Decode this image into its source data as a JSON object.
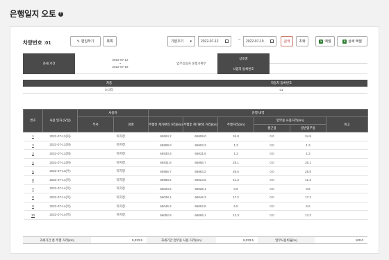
{
  "page": {
    "title": "은행일지 오토"
  },
  "vehicle": {
    "label": "차량번호 :01"
  },
  "toolbar": {
    "edit_label": "편집하기",
    "list_label": "목록",
    "period_select": "기본조기",
    "date_from": "2022-07-12",
    "date_to": "2022-07-19",
    "separator": "~",
    "search_label": "검색",
    "reset_label": "초화",
    "excel_label": "엑셀",
    "excel_detail_label": "상세 엑셀"
  },
  "info": {
    "period_label": "과세 기간",
    "period_start": "2022-07-12",
    "period_sep": "~",
    "period_end": "2022-07-19",
    "manager_label": "업무승용차 운행기록부",
    "trade_label": "상호명",
    "trade_value": "",
    "bizno_label": "사업자 등록번호",
    "bizno_value": "",
    "model_label": "차종",
    "model_value": "소나타",
    "reg_label": "자동차 등록번호",
    "reg_value": "01"
  },
  "table": {
    "headers": {
      "no": "번호",
      "date": "사용 일자 (요일)",
      "user": "사용자",
      "dept": "부서",
      "name": "성명",
      "run": "운행 내역",
      "before": "주행전 계기판의 거리(km)",
      "after": "주행후 계기판의 거리(km)",
      "dist": "주행거리(km)",
      "biz": "업무용 사용거리(km)",
      "commute": "출근용",
      "general": "일반업무용",
      "note": "비고"
    },
    "rows": [
      {
        "no": "1",
        "date": "2022-07-12(화)",
        "dept": "",
        "name": "미지정",
        "before": "65904.2",
        "after": "65909.0",
        "dist": "34.8",
        "commute": "0.0",
        "general": "34.8",
        "note": ""
      },
      {
        "no": "2",
        "date": "2022-07-12(화)",
        "dept": "",
        "name": "미지정",
        "before": "65909.0",
        "after": "65903.3",
        "dist": "1.3",
        "commute": "0.0",
        "general": "1.3",
        "note": ""
      },
      {
        "no": "3",
        "date": "2022-07-12(화)",
        "dept": "",
        "name": "미지정",
        "before": "65930.3",
        "after": "65931.6",
        "dist": "1.3",
        "commute": "0.0",
        "general": "1.3",
        "note": ""
      },
      {
        "no": "4",
        "date": "2022-07-12(화)",
        "dept": "",
        "name": "미지정",
        "before": "65931.6",
        "after": "65956.7",
        "dist": "25.1",
        "commute": "0.0",
        "general": "25.1",
        "note": ""
      },
      {
        "no": "5",
        "date": "2022-07-13(수)",
        "dept": "",
        "name": "미지정",
        "before": "65956.7",
        "after": "65983.2",
        "dist": "26.5",
        "commute": "0.0",
        "general": "26.5",
        "note": ""
      },
      {
        "no": "6",
        "date": "2022-07-14(목)",
        "dept": "",
        "name": "미지정",
        "before": "65983.2",
        "after": "66024.5",
        "dist": "41.3",
        "commute": "0.0",
        "general": "41.3",
        "note": ""
      },
      {
        "no": "7",
        "date": "2022-07-14(목)",
        "dept": "",
        "name": "미지정",
        "before": "66024.5",
        "after": "66025.1",
        "dist": "0.6",
        "commute": "0.0",
        "general": "0.6",
        "note": ""
      },
      {
        "no": "8",
        "date": "2022-07-14(목)",
        "dept": "",
        "name": "미지정",
        "before": "66028.1",
        "after": "66046.3",
        "dist": "17.2",
        "commute": "0.0",
        "general": "17.2",
        "note": ""
      },
      {
        "no": "9",
        "date": "2022-07-14(목)",
        "dept": "",
        "name": "미지정",
        "before": "66046.3",
        "after": "66052.8",
        "dist": "6.5",
        "commute": "0.0",
        "general": "6.5",
        "note": ""
      },
      {
        "no": "10",
        "date": "2022-07-14(목)",
        "dept": "",
        "name": "미지정",
        "before": "66052.8",
        "after": "66065.1",
        "dist": "12.3",
        "commute": "0.0",
        "general": "12.3",
        "note": ""
      }
    ]
  },
  "footer": {
    "total_label": "과세기간 총 주행 거리(km)",
    "total_value": "9,033.5",
    "biz_label": "과세기간 업무용 사용 거리(km)",
    "biz_value": "9,033.5",
    "ratio_label": "업무사용비율(%)",
    "ratio_value": "100.0"
  }
}
